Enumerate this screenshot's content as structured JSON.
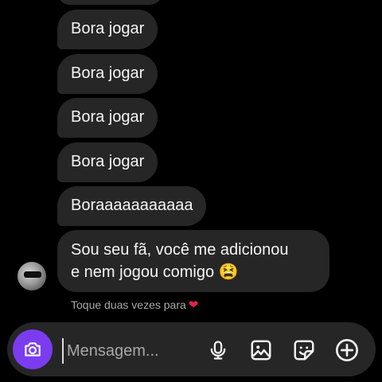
{
  "messages": [
    {
      "text": "Bora jogar"
    },
    {
      "text": "Bora jogar"
    },
    {
      "text": "Bora jogar"
    },
    {
      "text": "Bora jogar"
    },
    {
      "text": "Boraaaaaaaaaaa"
    }
  ],
  "last_message": {
    "line1": "Sou seu fã, você me adicionou",
    "line2": "e nem jogou comigo 😫"
  },
  "hint": {
    "text": "Toque duas vezes para",
    "icon": "heart-icon"
  },
  "composer": {
    "placeholder": "Mensagem..."
  },
  "icons": {
    "camera": "camera-icon",
    "mic": "microphone-icon",
    "gallery": "image-icon",
    "sticker": "sticker-icon",
    "more": "plus-circle-icon"
  },
  "colors": {
    "background": "#000000",
    "bubble": "#262626",
    "camera_button": "#7b3cf0",
    "heart": "#e0244a"
  }
}
